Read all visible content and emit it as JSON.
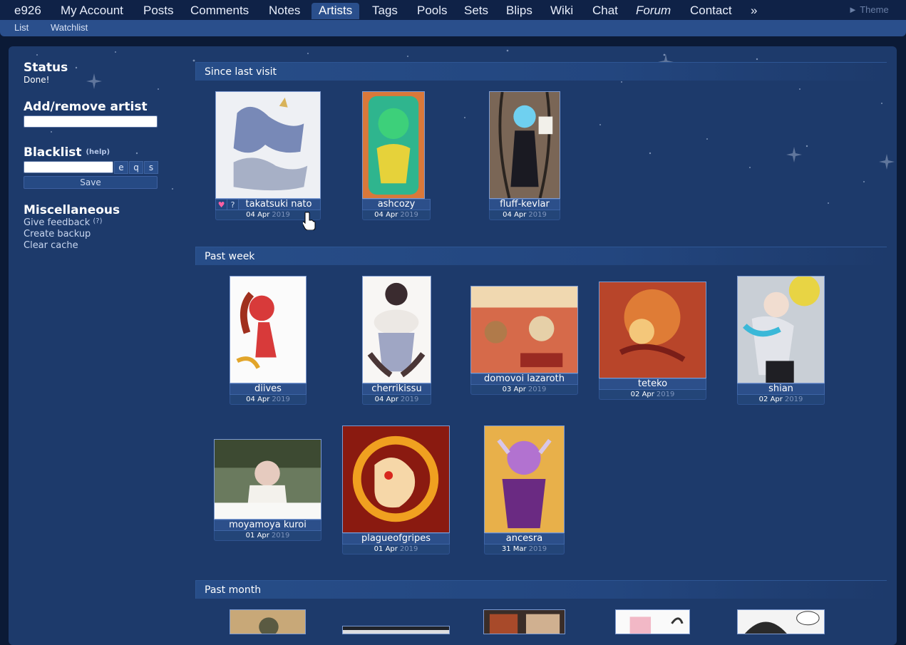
{
  "nav": {
    "items": [
      "e926",
      "My Account",
      "Posts",
      "Comments",
      "Notes",
      "Artists",
      "Tags",
      "Pools",
      "Sets",
      "Blips",
      "Wiki",
      "Chat",
      "Forum",
      "Contact",
      "»"
    ],
    "active": "Artists",
    "theme_label": "► Theme"
  },
  "subnav": {
    "items": [
      "List",
      "Watchlist"
    ]
  },
  "sidebar": {
    "status_heading": "Status",
    "status_value": "Done!",
    "add_heading": "Add/remove artist",
    "blacklist_heading": "Blacklist",
    "blacklist_help": "(help)",
    "blacklist_buttons": [
      "e",
      "q",
      "s"
    ],
    "save_label": "Save",
    "misc_heading": "Miscellaneous",
    "misc_links": [
      "Give feedback",
      "Create backup",
      "Clear cache"
    ],
    "feedback_help": "(?)"
  },
  "sections": [
    {
      "title": "Since last visit",
      "artists": [
        {
          "name": "takatsuki nato",
          "date": "04 Apr",
          "year": "2019",
          "hovered": true
        },
        {
          "name": "ashcozy",
          "date": "04 Apr",
          "year": "2019"
        },
        {
          "name": "fluff-kevlar",
          "date": "04 Apr",
          "year": "2019"
        }
      ]
    },
    {
      "title": "Past week",
      "artists": [
        {
          "name": "diives",
          "date": "04 Apr",
          "year": "2019"
        },
        {
          "name": "cherrikissu",
          "date": "04 Apr",
          "year": "2019"
        },
        {
          "name": "domovoi lazaroth",
          "date": "03 Apr",
          "year": "2019"
        },
        {
          "name": "teteko",
          "date": "02 Apr",
          "year": "2019"
        },
        {
          "name": "shian",
          "date": "02 Apr",
          "year": "2019"
        },
        {
          "name": "moyamoya kuroi",
          "date": "01 Apr",
          "year": "2019"
        },
        {
          "name": "plagueofgripes",
          "date": "01 Apr",
          "year": "2019"
        },
        {
          "name": "ancesra",
          "date": "31 Mar",
          "year": "2019"
        }
      ]
    },
    {
      "title": "Past month",
      "artists": []
    }
  ],
  "card_buttons": {
    "fav": "♥",
    "question": "?"
  },
  "colors": {
    "page_bg": "#0b1a36",
    "panel_bg": "#1d3a6b",
    "nav_active": "#2a4f8c",
    "year_text": "#7f95bd"
  }
}
